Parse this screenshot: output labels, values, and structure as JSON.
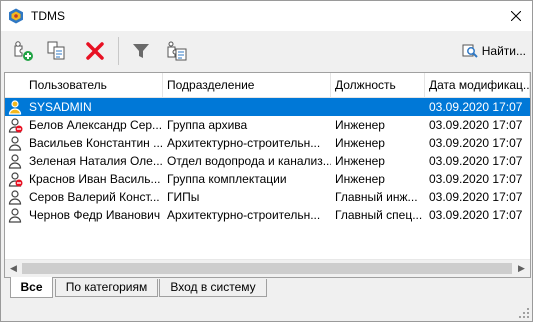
{
  "window": {
    "title": "TDMS"
  },
  "toolbar": {
    "buttons": [
      "add-user-icon",
      "copy-users-icon",
      "delete-icon",
      "filter-icon",
      "user-properties-icon"
    ],
    "find_label": "Найти..."
  },
  "grid": {
    "columns": [
      "Пользователь",
      "Подразделение",
      "Должность",
      "Дата модификац..."
    ],
    "rows": [
      {
        "user": "SYSADMIN",
        "dept": "",
        "position": "",
        "date": "03.09.2020 17:07",
        "icon": "admin-user-icon",
        "selected": true
      },
      {
        "user": "Белов Александр Сер...",
        "dept": "Группа архива",
        "position": "Инженер",
        "date": "03.09.2020 17:07",
        "icon": "blocked-user-icon"
      },
      {
        "user": "Васильев Константин ...",
        "dept": "Архитектурно-строительн...",
        "position": "Инженер",
        "date": "03.09.2020 17:07",
        "icon": "user-icon"
      },
      {
        "user": "Зеленая Наталия Оле...",
        "dept": "Отдел водопрода и канализ...",
        "position": "Инженер",
        "date": "03.09.2020 17:07",
        "icon": "user-icon"
      },
      {
        "user": "Краснов Иван Василь...",
        "dept": "Группа комплектации",
        "position": "Инженер",
        "date": "03.09.2020 17:07",
        "icon": "blocked-user-icon"
      },
      {
        "user": "Серов Валерий Конст...",
        "dept": "ГИПы",
        "position": "Главный инж...",
        "date": "03.09.2020 17:07",
        "icon": "user-icon"
      },
      {
        "user": "Чернов Федр Иванович",
        "dept": "Архитектурно-строительн...",
        "position": "Главный спец...",
        "date": "03.09.2020 17:07",
        "icon": "user-icon"
      }
    ]
  },
  "tabs": [
    "Все",
    "По категориям",
    "Вход в систему"
  ],
  "colors": {
    "selection": "#0078d7",
    "delete": "#e81123"
  }
}
